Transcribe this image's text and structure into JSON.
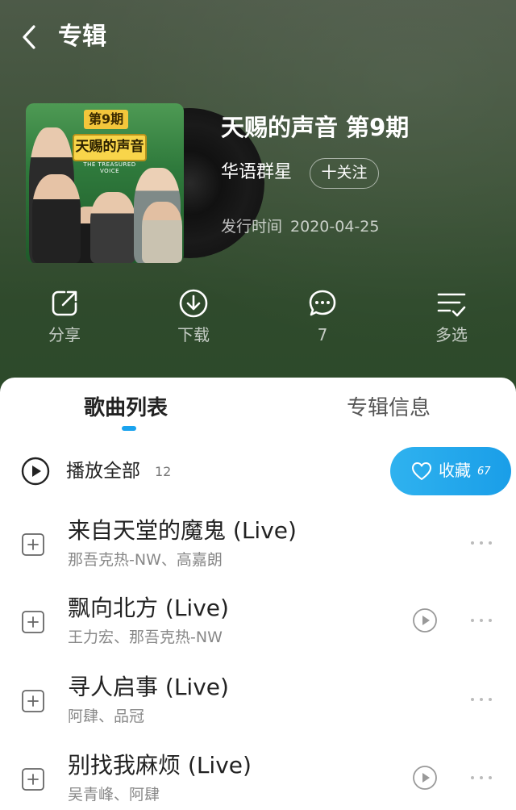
{
  "header": {
    "title": "专辑",
    "back_icon": "chevron-left-icon"
  },
  "album": {
    "title": "天赐的声音 第9期",
    "artist": "华语群星",
    "follow_label": "十关注",
    "release_label": "发行时间",
    "release_date": "2020-04-25",
    "cover": {
      "episode_tag": "第9期",
      "logo_text": "天赐的声音",
      "logo_sub": "THE TREASURED VOICE"
    }
  },
  "actions": [
    {
      "icon": "share-icon",
      "label": "分享"
    },
    {
      "icon": "download-icon",
      "label": "下载"
    },
    {
      "icon": "comment-icon",
      "label": "7"
    },
    {
      "icon": "multi-select-icon",
      "label": "多选"
    }
  ],
  "tabs": {
    "songs": "歌曲列表",
    "info": "专辑信息"
  },
  "playall": {
    "label": "播放全部",
    "count": "12"
  },
  "collect": {
    "label": "收藏",
    "count": "67"
  },
  "songs": [
    {
      "title": "来自天堂的魔鬼 (Live)",
      "artists": "那吾克热-NW、高嘉朗",
      "has_mv": false
    },
    {
      "title": "飘向北方 (Live)",
      "artists": "王力宏、那吾克热-NW",
      "has_mv": true
    },
    {
      "title": "寻人启事 (Live)",
      "artists": "阿肆、品冠",
      "has_mv": false
    },
    {
      "title": "别找我麻烦 (Live)",
      "artists": "吴青峰、阿肆",
      "has_mv": true
    }
  ],
  "colors": {
    "accent": "#1aa3ee",
    "hero_bg": "#3d5238"
  }
}
